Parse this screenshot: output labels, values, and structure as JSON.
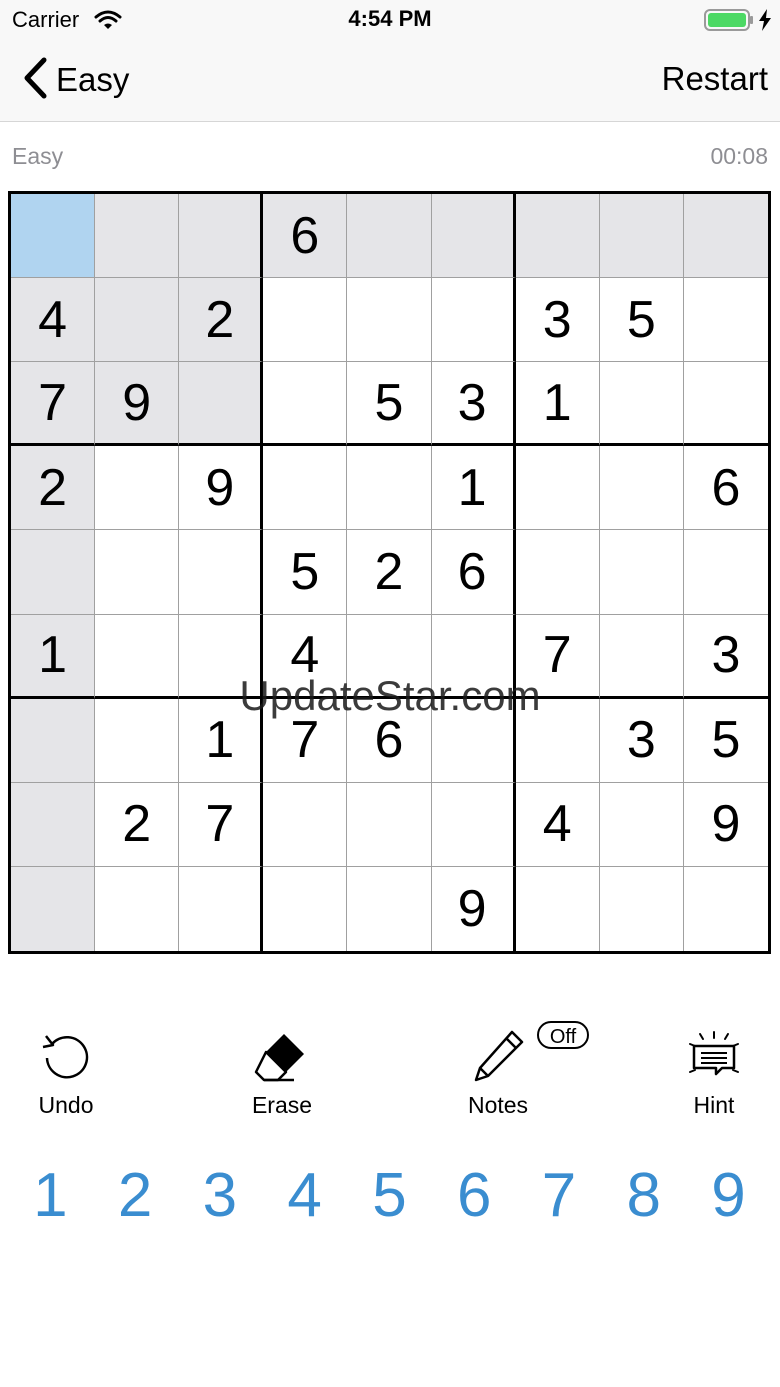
{
  "status_bar": {
    "carrier": "Carrier",
    "time": "4:54 PM",
    "battery_color": "#4cd964"
  },
  "nav": {
    "back_label": "Easy",
    "restart_label": "Restart"
  },
  "info": {
    "difficulty": "Easy",
    "timer": "00:08"
  },
  "board": {
    "selected_cell": [
      0,
      0
    ],
    "rows": [
      [
        "",
        "",
        "",
        "6",
        "",
        "",
        "",
        "",
        ""
      ],
      [
        "4",
        "",
        "2",
        "",
        "",
        "",
        "3",
        "5",
        ""
      ],
      [
        "7",
        "9",
        "",
        "",
        "5",
        "3",
        "1",
        "",
        ""
      ],
      [
        "2",
        "",
        "9",
        "",
        "",
        "1",
        "",
        "",
        "6"
      ],
      [
        "",
        "",
        "",
        "5",
        "2",
        "6",
        "",
        "",
        ""
      ],
      [
        "1",
        "",
        "",
        "4",
        "",
        "",
        "7",
        "",
        "3"
      ],
      [
        "",
        "",
        "1",
        "7",
        "6",
        "",
        "",
        "3",
        "5"
      ],
      [
        "",
        "2",
        "7",
        "",
        "",
        "",
        "4",
        "",
        "9"
      ],
      [
        "",
        "",
        "",
        "",
        "",
        "9",
        "",
        "",
        ""
      ]
    ]
  },
  "watermark": "UpdateStar.com",
  "toolbar": {
    "undo_label": "Undo",
    "erase_label": "Erase",
    "notes_label": "Notes",
    "notes_state": "Off",
    "hint_label": "Hint"
  },
  "numpad": {
    "keys": [
      "1",
      "2",
      "3",
      "4",
      "5",
      "6",
      "7",
      "8",
      "9"
    ],
    "color": "#3a8dd0"
  }
}
